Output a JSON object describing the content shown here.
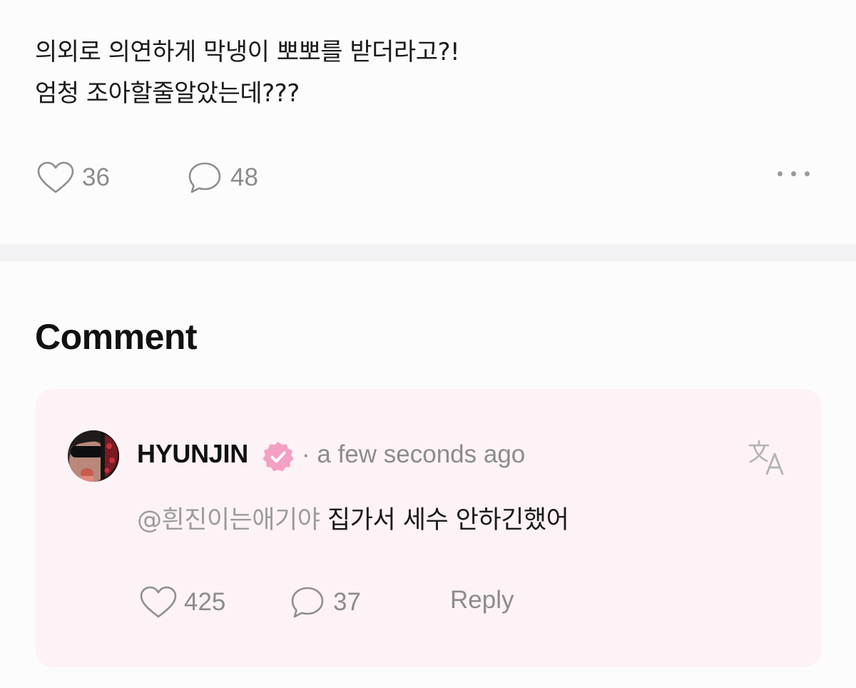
{
  "post": {
    "lines": [
      "의외로 의연하게 막냉이 뽀뽀를 받더라고?!",
      "엄청 조아할줄알았는데???"
    ],
    "like_count": "36",
    "comment_count": "48",
    "more_icon": "more-horizontal-icon"
  },
  "comments_section": {
    "heading": "Comment"
  },
  "comment": {
    "author": "HYUNJIN",
    "verified_icon": "verified-badge-icon",
    "separator": "·",
    "time": "a few seconds ago",
    "mention": "@흰진이는애기야",
    "text": "집가서 세수 안하긴했어",
    "like_count": "425",
    "reply_count": "37",
    "reply_label": "Reply"
  },
  "colors": {
    "accent_pink": "#f49fc4",
    "card_background": "#fdf2f5",
    "muted_text": "#8b8b8e"
  }
}
